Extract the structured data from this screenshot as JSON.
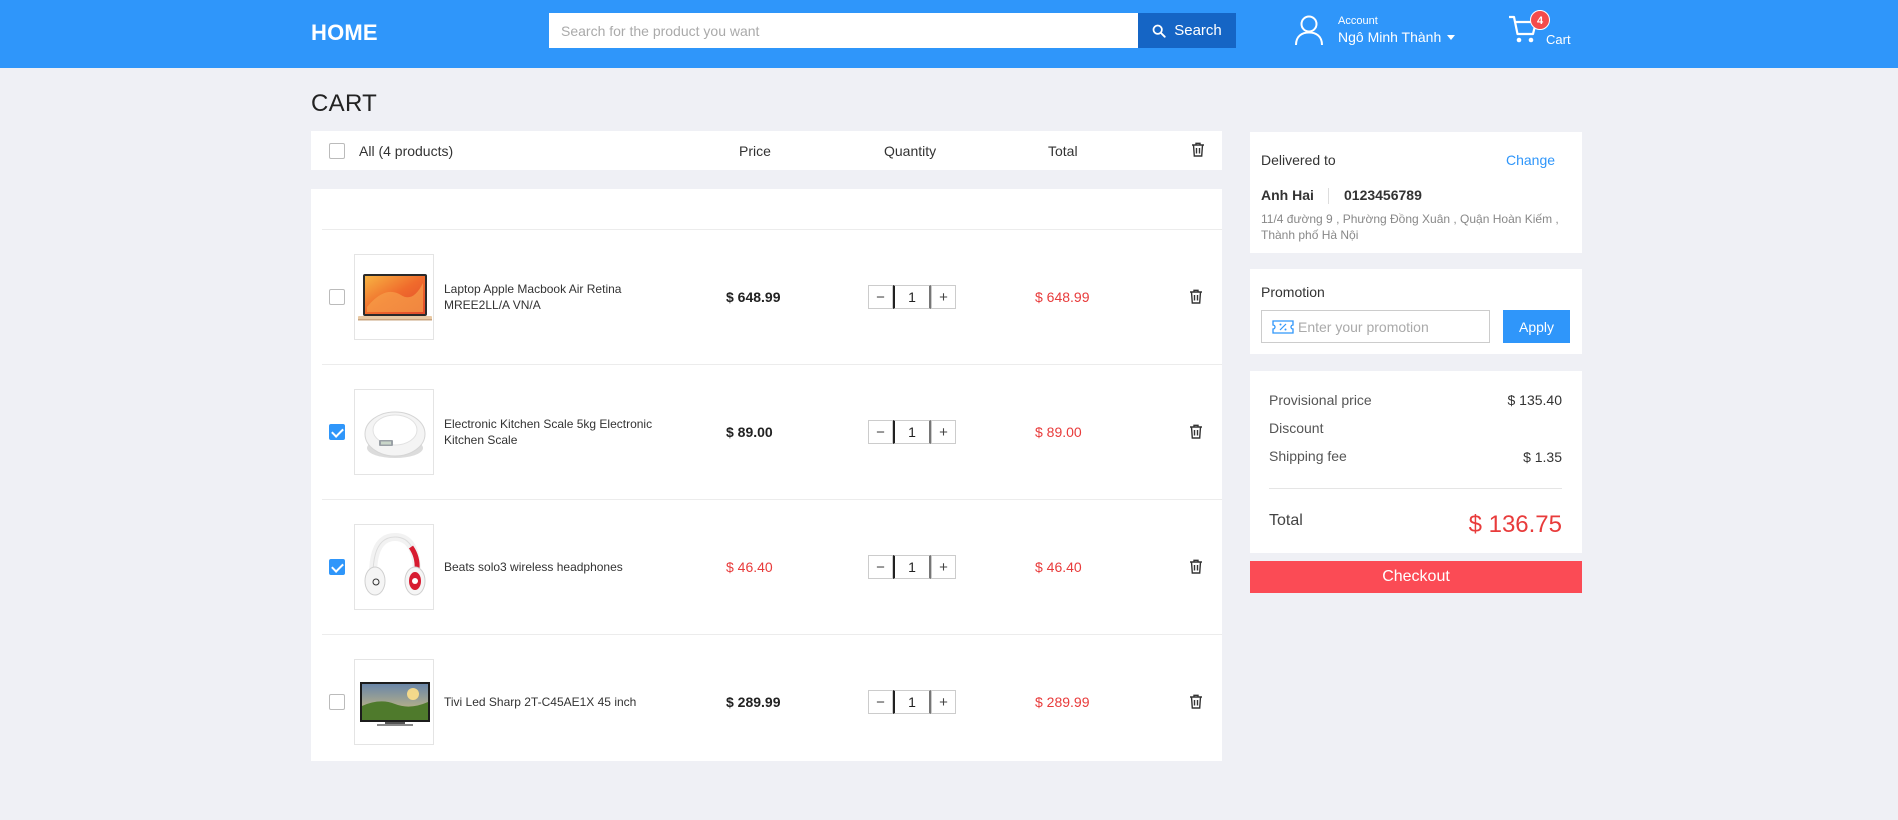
{
  "header": {
    "logo": "HOME",
    "search": {
      "placeholder": "Search for the product you want",
      "button_label": "Search"
    },
    "account": {
      "label": "Account",
      "name": "Ngô Minh Thành"
    },
    "cart": {
      "label": "Cart",
      "count": "4"
    }
  },
  "page": {
    "title": "CART"
  },
  "table": {
    "all_label": "All (4 products)",
    "col_price": "Price",
    "col_quantity": "Quantity",
    "col_total": "Total"
  },
  "items": [
    {
      "name": "Laptop Apple Macbook Air Retina MREE2LL/A VN/A",
      "price": "$ 648.99",
      "quantity": "1",
      "total": "$ 648.99",
      "checked": false,
      "price_sale": false,
      "image_icon": "laptop-image"
    },
    {
      "name": "Electronic Kitchen Scale 5kg Electronic Kitchen Scale",
      "price": "$ 89.00",
      "quantity": "1",
      "total": "$ 89.00",
      "checked": true,
      "price_sale": false,
      "image_icon": "kitchen-scale-image"
    },
    {
      "name": "Beats solo3 wireless headphones",
      "price": "$ 46.40",
      "quantity": "1",
      "total": "$ 46.40",
      "checked": true,
      "price_sale": true,
      "image_icon": "headphones-image"
    },
    {
      "name": "Tivi Led Sharp 2T-C45AE1X 45 inch",
      "price": "$ 289.99",
      "quantity": "1",
      "total": "$ 289.99",
      "checked": false,
      "price_sale": false,
      "image_icon": "tv-image"
    }
  ],
  "delivery": {
    "title": "Delivered to",
    "change_label": "Change",
    "name": "Anh Hai",
    "phone": "0123456789",
    "address": "11/4 đường 9 , Phường Đồng Xuân , Quận Hoàn Kiếm , Thành phố Hà Nội"
  },
  "promotion": {
    "title": "Promotion",
    "placeholder": "Enter your promotion",
    "apply_label": "Apply"
  },
  "summary": {
    "provisional_label": "Provisional price",
    "provisional_value": "$ 135.40",
    "discount_label": "Discount",
    "shipping_label": "Shipping fee",
    "shipping_value": "$ 1.35",
    "total_label": "Total",
    "total_value": "$ 136.75"
  },
  "checkout_label": "Checkout",
  "colors": {
    "primary": "#2f96fa",
    "search_button": "#1565c5",
    "sale": "#e83b3b",
    "checkout": "#fb4b55",
    "background": "#eff0f5"
  }
}
